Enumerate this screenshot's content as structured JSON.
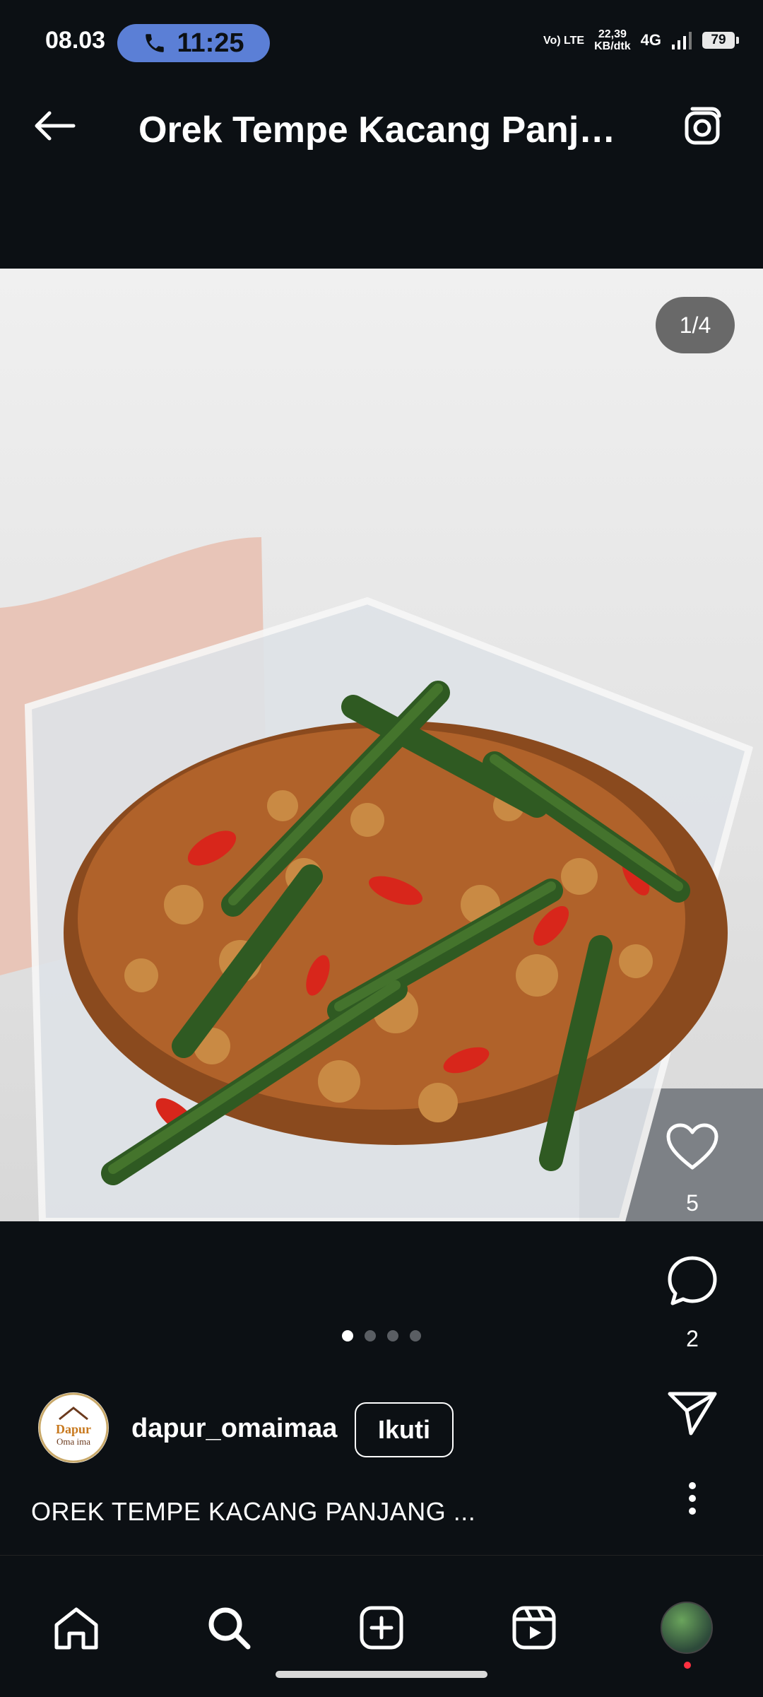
{
  "status_bar": {
    "time": "08.03",
    "call_time": "11:25",
    "volte": "Vo) LTE",
    "speed_value": "22,39",
    "speed_unit": "KB/dtk",
    "network": "4G",
    "battery": "79"
  },
  "header": {
    "title": "Orek Tempe Kacang Panjang OREK TEMPE KACANG PANJANG",
    "back_icon": "arrow-left-icon",
    "camera_icon": "camera-icon"
  },
  "post": {
    "image_counter": "1/4",
    "image_count": 4,
    "current_image": 1,
    "likes": "5",
    "comments": "2",
    "author": {
      "username": "dapur_omaimaa",
      "follow_label": "Ikuti",
      "avatar_text": "Dapur Oma ima"
    },
    "caption": "OREK TEMPE KACANG PANJANG ..."
  },
  "bottom_nav": {
    "items": [
      "home-icon",
      "search-icon",
      "create-icon",
      "reels-icon",
      "profile-avatar"
    ]
  },
  "colors": {
    "background": "#0c1014",
    "call_pill": "#5b7fd6",
    "notification": "#ff3040"
  }
}
